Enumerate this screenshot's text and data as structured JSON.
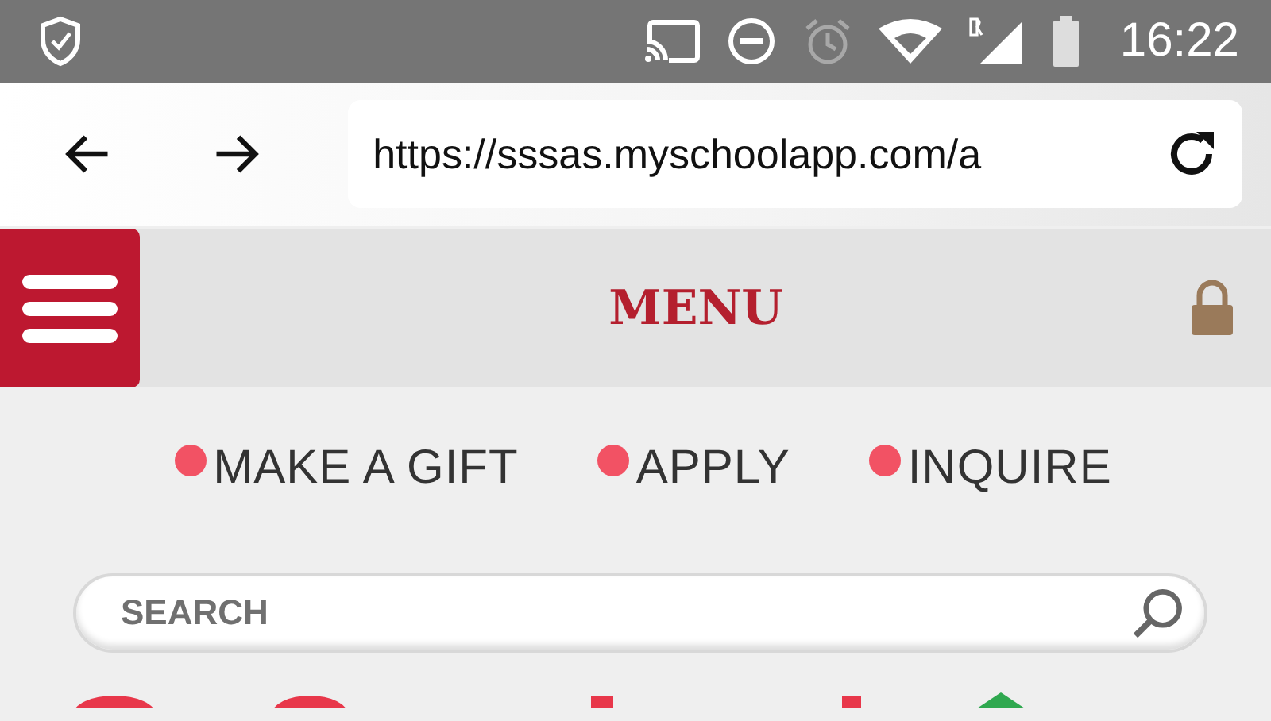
{
  "status_bar": {
    "time": "16:22"
  },
  "browser": {
    "url": "https://sssas.myschoolapp.com/a"
  },
  "header": {
    "title": "MENU"
  },
  "quick_links": [
    {
      "label": "MAKE A GIFT"
    },
    {
      "label": "APPLY"
    },
    {
      "label": "INQUIRE"
    }
  ],
  "search": {
    "placeholder": "SEARCH"
  }
}
